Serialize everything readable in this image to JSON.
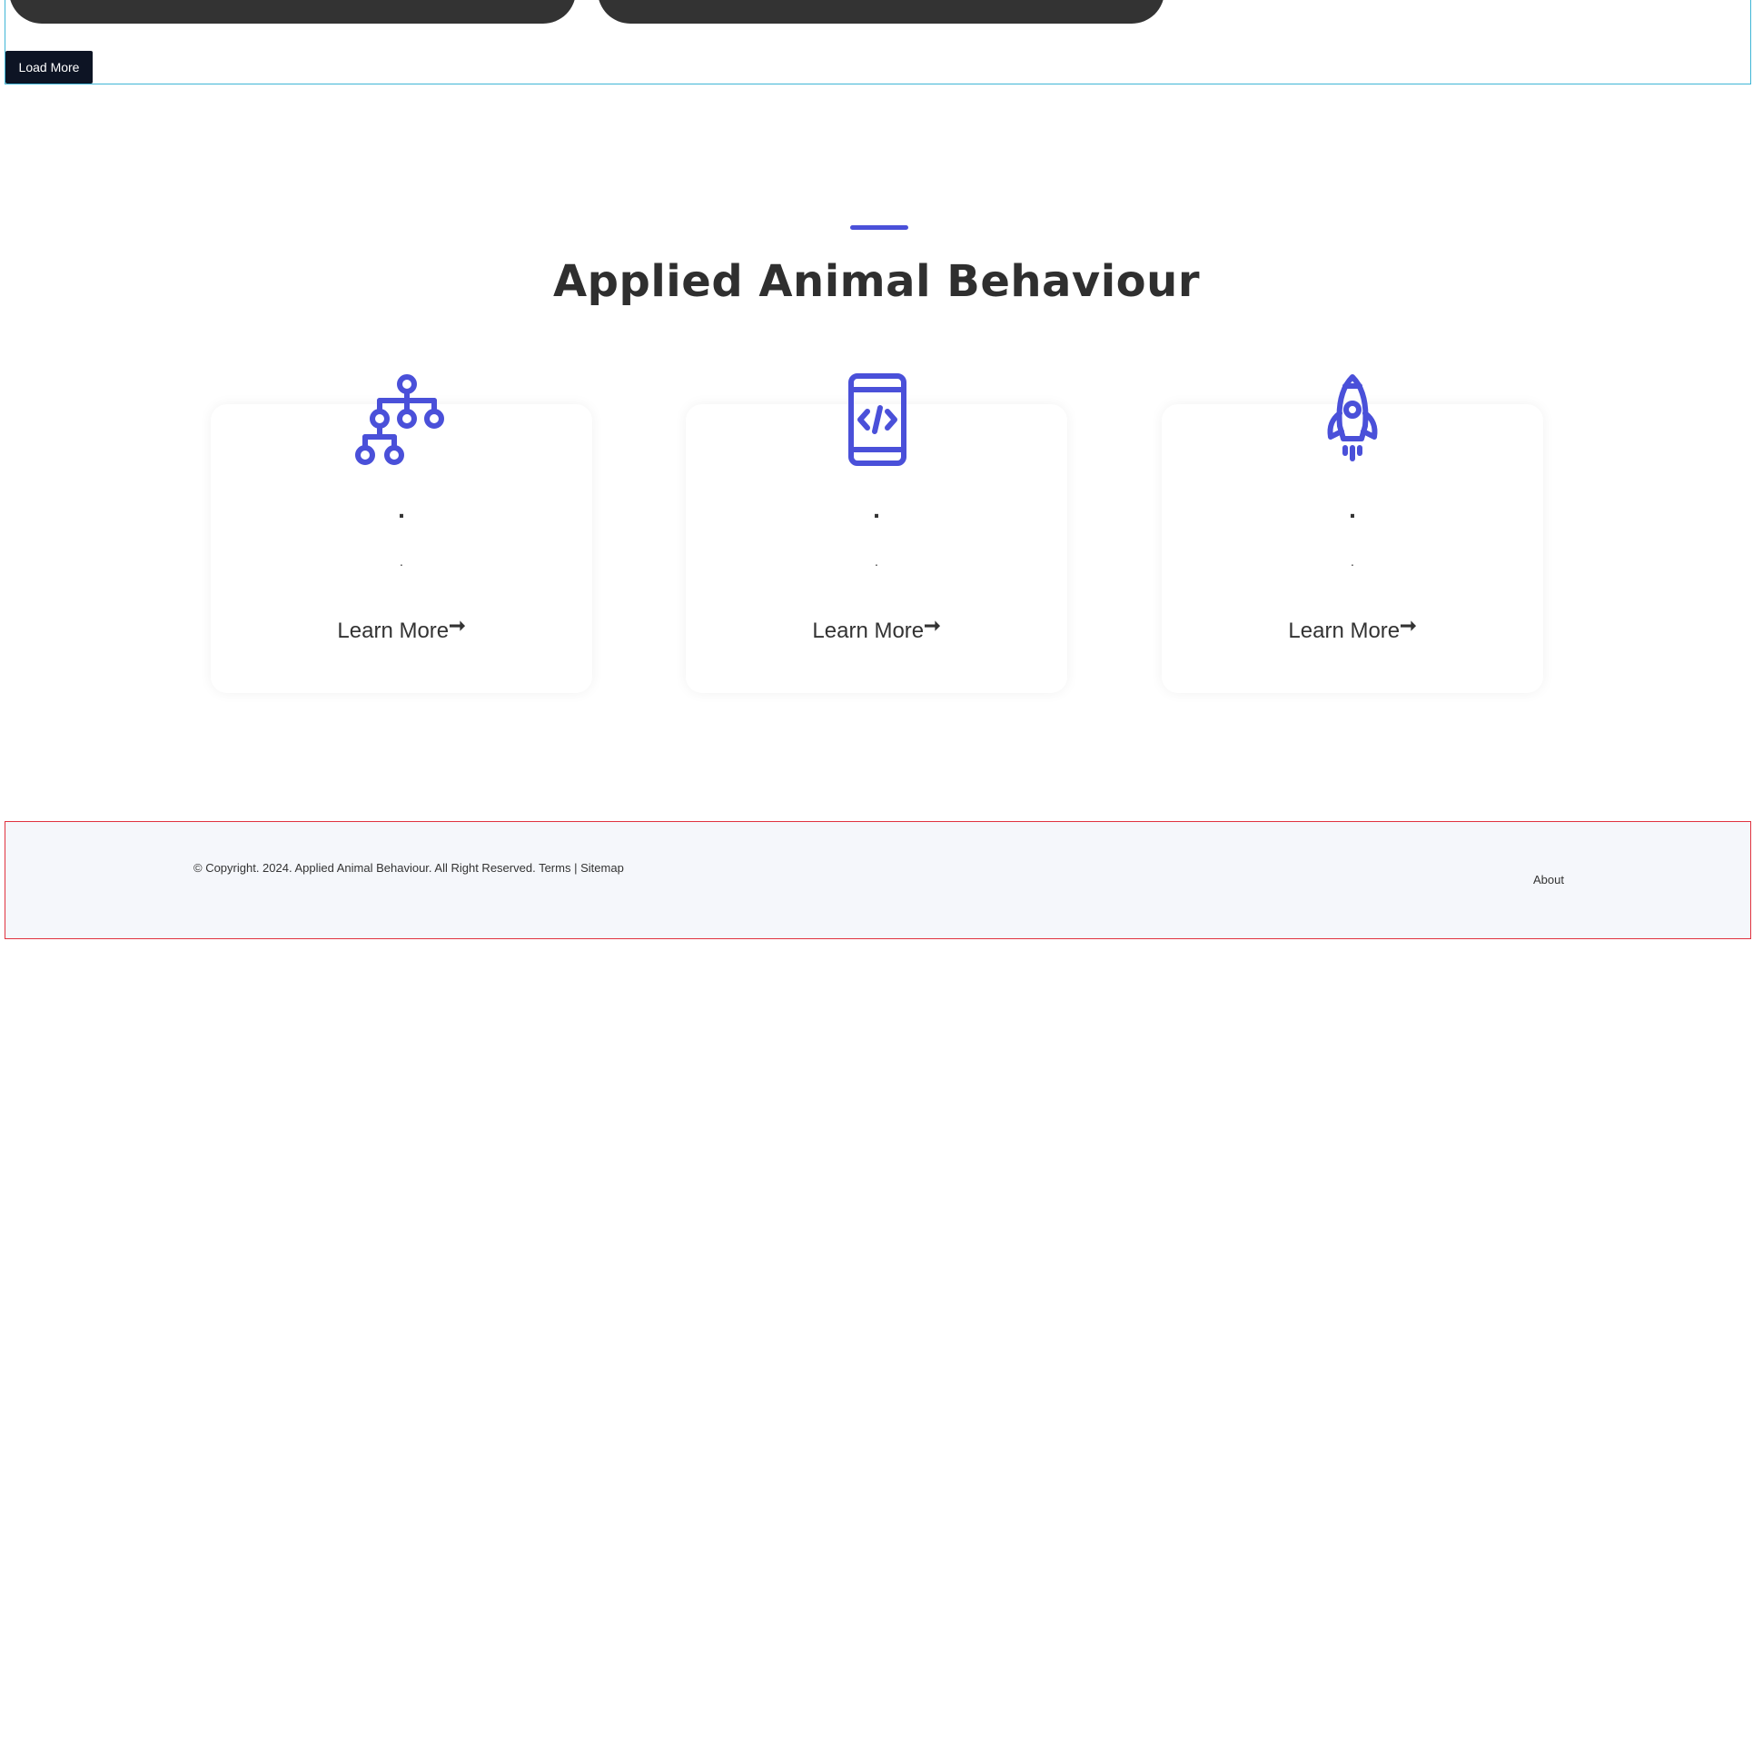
{
  "top": {
    "load_more_label": "Load More"
  },
  "section": {
    "title": "Applied Animal Behaviour",
    "accent_color": "#4a50d9"
  },
  "cards": [
    {
      "icon": "sitemap-icon",
      "title": ".",
      "description": ".",
      "link_label": "Learn More",
      "arrow": "➞"
    },
    {
      "icon": "mobile-code-icon",
      "title": ".",
      "description": ".",
      "link_label": "Learn More",
      "arrow": "➞"
    },
    {
      "icon": "rocket-icon",
      "title": ".",
      "description": ".",
      "link_label": "Learn More",
      "arrow": "➞"
    }
  ],
  "footer": {
    "copyright_text": "© Copyright. 2024. Applied Animal Behaviour. All Right Reserved.",
    "terms_label": "Terms",
    "separator": "|",
    "sitemap_label": "Sitemap",
    "about_label": "About"
  }
}
